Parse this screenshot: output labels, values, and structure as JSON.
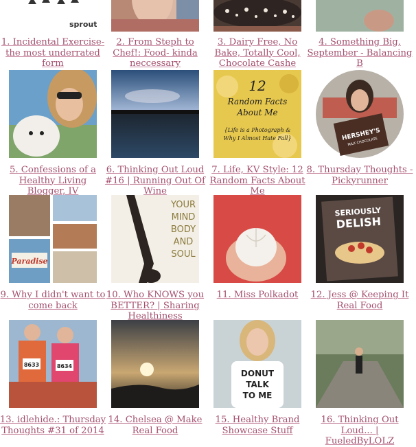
{
  "links": [
    {
      "label": "1. Incidental Exercise- the most underrated form",
      "image": "sprout-logo-thumbnail"
    },
    {
      "label": "2. From Steph to Chef!: Food- kinda neccessary",
      "image": "person-thumbnail"
    },
    {
      "label": "3. Dairy Free, No Bake, Totally Cool, Chocolate Cashe",
      "image": "chocolate-bark-thumbnail"
    },
    {
      "label": "4. Something Big, September - Balancing B",
      "image": "person-hand-thumbnail"
    },
    {
      "label": "5. Confessions of a Healthy Living Blogger, IV",
      "image": "selfie-with-dog-thumbnail"
    },
    {
      "label": "6. Thinking Out Loud #16 | Running Out Of Wine",
      "image": "sunset-lake-thumbnail"
    },
    {
      "label": "7. Life, KV Style: 12 Random Facts About Me",
      "image": "12-random-facts-thumbnail",
      "image_text": [
        "12",
        "Random Facts",
        "About Me",
        "{Life is a Photograph &",
        "Why I Almost Hate Fall}"
      ]
    },
    {
      "label": "8. Thursday Thoughts - Pickyrunner",
      "image": "hersheys-woman-thumbnail",
      "image_text": [
        "HERSHEY'S",
        "MILK CHOCOLATE"
      ]
    },
    {
      "label": "9. Why I didn't want to come back",
      "image": "paradise-collage-thumbnail",
      "image_text": [
        "Paradise"
      ]
    },
    {
      "label": "10. Who KNOWS you BETTER? | Sharing Healthiness",
      "image": "your-mind-body-soul-thumbnail",
      "image_text": [
        "YOUR",
        "MIND",
        "BODY",
        "AND",
        "SOUL"
      ]
    },
    {
      "label": "11. Miss Polkadot",
      "image": "garlic-in-hand-thumbnail"
    },
    {
      "label": "12. Jess @ Keeping It Real Food",
      "image": "seriously-delish-book-thumbnail",
      "image_text": [
        "SERIOUSLY",
        "DELISH"
      ]
    },
    {
      "label": "13. idlehide.: Thursday Thoughts #31 of 2014",
      "image": "race-runners-thumbnail",
      "image_text": [
        "8633",
        "8634"
      ]
    },
    {
      "label": "14. Chelsea @ Make Real Food",
      "image": "sunset-clouds-thumbnail"
    },
    {
      "label": "15. Healthy Brand Showcase Stuff",
      "image": "woman-donut-shirt-thumbnail",
      "image_text": [
        "DONUT",
        "TALK",
        "TO ME"
      ]
    },
    {
      "label": "16. Thinking Out Loud... | FueledByLOLZ",
      "image": "trail-running-thumbnail"
    }
  ],
  "colors": {
    "link": "#a4506f",
    "background": "#ffffff"
  }
}
